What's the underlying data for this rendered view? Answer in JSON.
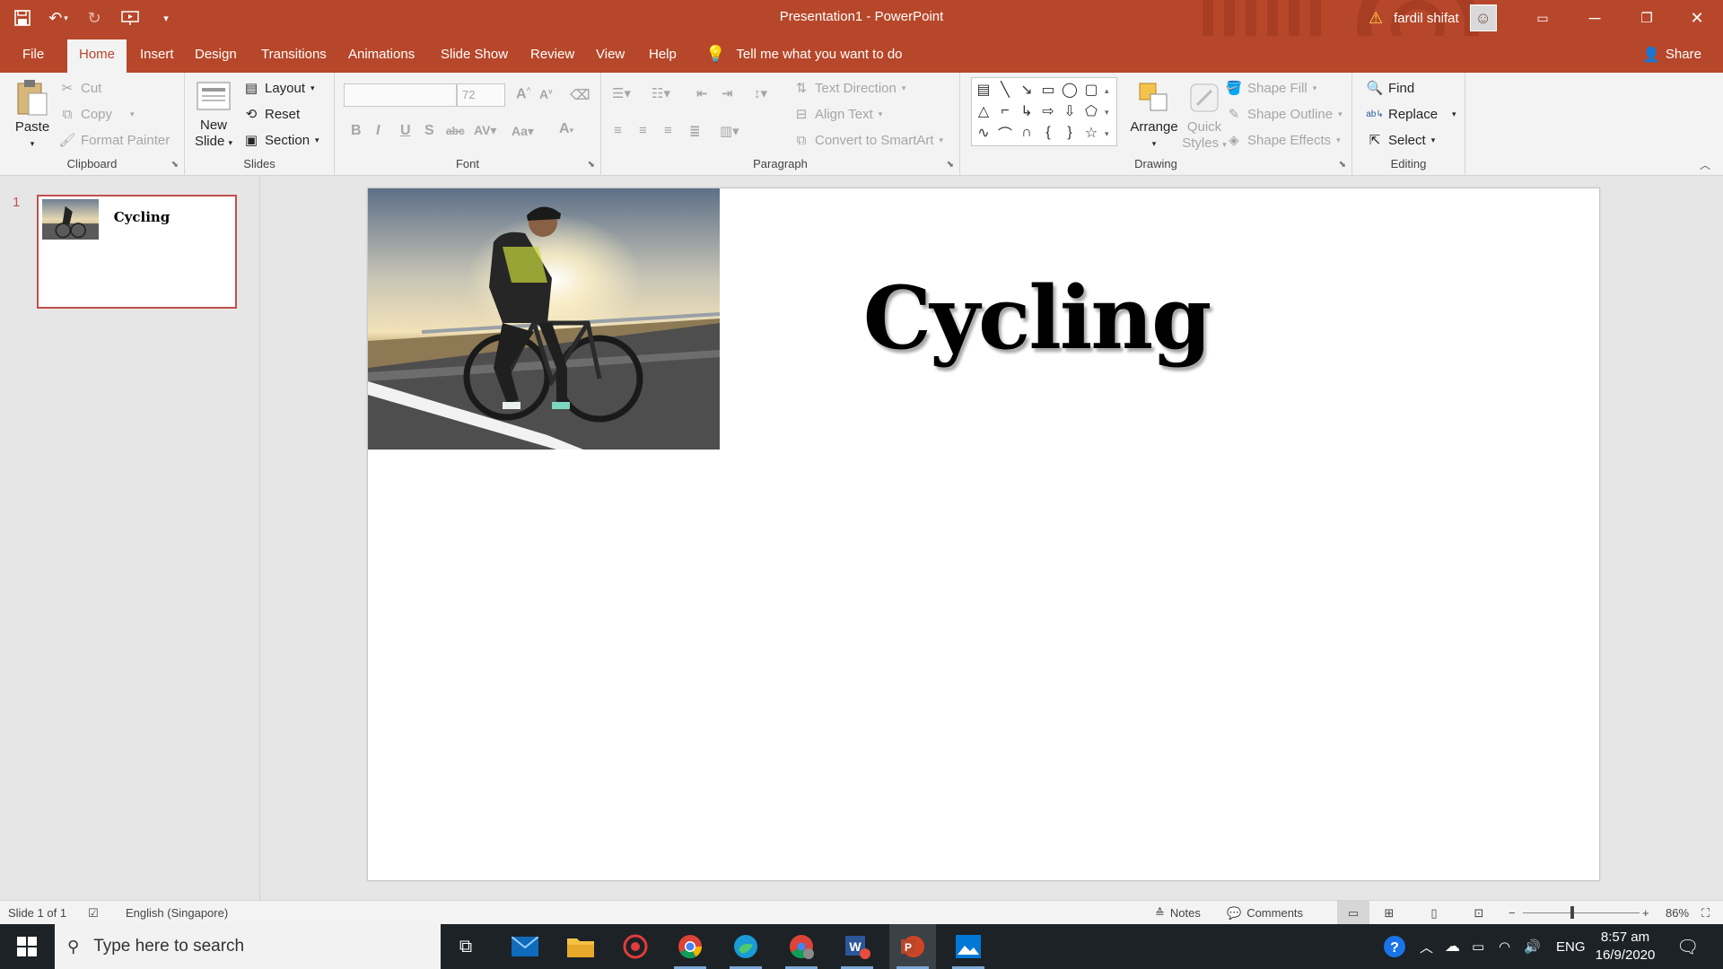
{
  "window": {
    "title": "Presentation1  -  PowerPoint",
    "user_name": "fardil shifat"
  },
  "colors": {
    "accent": "#b7472a",
    "selection": "#c0504d",
    "taskbar": "#1c2226"
  },
  "qat": {
    "icons": [
      "save-icon",
      "undo-icon",
      "redo-icon",
      "start-from-beginning-icon",
      "customize-qat-icon"
    ]
  },
  "tabs": [
    "File",
    "Home",
    "Insert",
    "Design",
    "Transitions",
    "Animations",
    "Slide Show",
    "Review",
    "View",
    "Help"
  ],
  "active_tab": "Home",
  "tell_me": "Tell me what you want to do",
  "share": "Share",
  "ribbon": {
    "clipboard": {
      "label": "Clipboard",
      "paste": "Paste",
      "cut": "Cut",
      "copy": "Copy",
      "format_painter": "Format Painter"
    },
    "slides": {
      "label": "Slides",
      "new_slide_1": "New",
      "new_slide_2": "Slide",
      "layout": "Layout",
      "reset": "Reset",
      "section": "Section"
    },
    "font": {
      "label": "Font",
      "font_name": "",
      "font_size": "72"
    },
    "paragraph": {
      "label": "Paragraph",
      "text_direction": "Text Direction",
      "align_text": "Align Text",
      "convert_smartart": "Convert to SmartArt"
    },
    "drawing": {
      "label": "Drawing",
      "arrange": "Arrange",
      "quick_styles_1": "Quick",
      "quick_styles_2": "Styles",
      "shape_fill": "Shape Fill",
      "shape_outline": "Shape Outline",
      "shape_effects": "Shape Effects"
    },
    "editing": {
      "label": "Editing",
      "find": "Find",
      "replace": "Replace",
      "select": "Select"
    }
  },
  "thumbnail": {
    "number": "1",
    "title": "Cycling"
  },
  "slide": {
    "title": "Cycling"
  },
  "status": {
    "slide_of": "Slide 1 of 1",
    "language": "English (Singapore)",
    "notes": "Notes",
    "comments": "Comments",
    "zoom": "86%",
    "zoom_level": 0.86
  },
  "taskbar": {
    "search_placeholder": "Type here to search",
    "lang": "ENG",
    "time": "8:57 am",
    "date": "16/9/2020"
  }
}
